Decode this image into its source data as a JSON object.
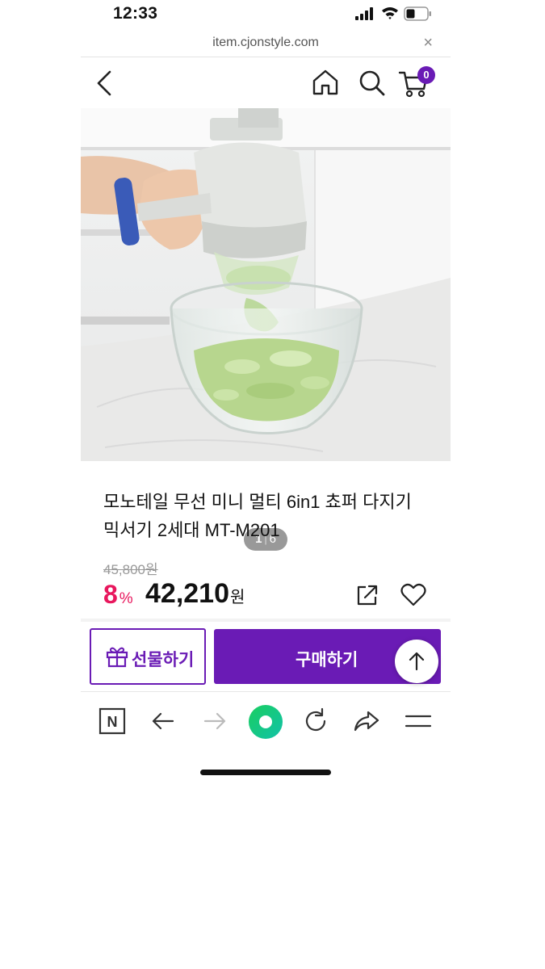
{
  "status_bar": {
    "time": "12:33",
    "icons": [
      "signal-icon",
      "wifi-icon",
      "battery-icon"
    ]
  },
  "browser": {
    "url": "item.cjonstyle.com",
    "close_label": "×"
  },
  "header": {
    "icons": [
      "back-arrow-icon",
      "home-icon",
      "search-icon",
      "cart-icon"
    ],
    "cart_count": "0"
  },
  "gallery": {
    "current": "1",
    "separator": "|",
    "total": "6"
  },
  "product": {
    "title": "모노테일 무선 미니 멀티 6in1 쵸퍼 다지기 믹서기 2세대 MT-M201",
    "original_price": "45,800원",
    "discount": "8",
    "discount_unit": "%",
    "price": "42,210",
    "currency": "원"
  },
  "actions": {
    "gift_label": "선물하기",
    "buy_label": "구매하기"
  },
  "toolbar": {
    "icons": [
      "naver-n-icon",
      "browser-back-icon",
      "browser-forward-icon",
      "green-dot-icon",
      "reload-icon",
      "share-arrow-icon",
      "menu-icon"
    ],
    "naver_label": "N"
  },
  "colors": {
    "accent": "#6a1bb5",
    "discount": "#e8175d",
    "green": "#19ce60"
  }
}
